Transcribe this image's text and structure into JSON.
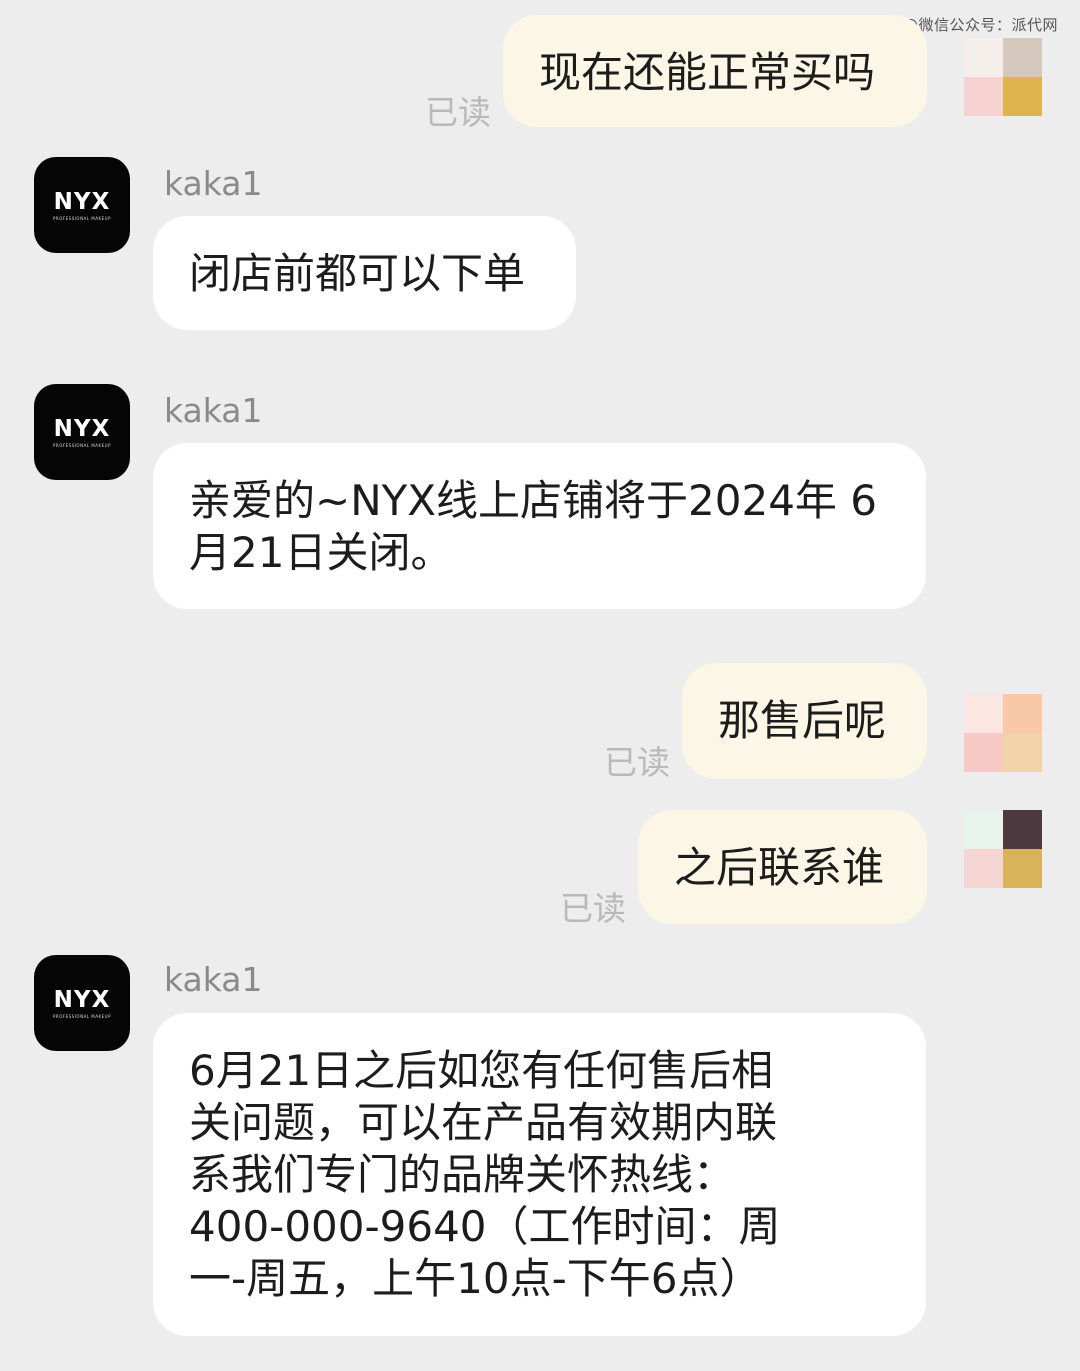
{
  "watermark": "@微信公众号：派代网",
  "read_label": "已读",
  "messages": {
    "m1": {
      "text": "现在还能正常买吗",
      "read": "已读"
    },
    "m2": {
      "sender": "kaka1",
      "text": "闭店前都可以下单",
      "avatar_logo": "NYX",
      "avatar_sub": "PROFESSIONAL MAKEUP"
    },
    "m3": {
      "sender": "kaka1",
      "line1": "亲爱的~NYX线上店铺将于2024年 6",
      "line2": "月21日关闭。",
      "avatar_logo": "NYX",
      "avatar_sub": "PROFESSIONAL MAKEUP"
    },
    "m4": {
      "text": "那售后呢",
      "read": "已读"
    },
    "m5": {
      "text": "之后联系谁",
      "read": "已读"
    },
    "m6": {
      "sender": "kaka1",
      "lines": [
        "6月21日之后如您有任何售后相",
        "关问题，可以在产品有效期内联",
        "系我们专门的品牌关怀热线：",
        "400-000-9640（工作时间：周",
        "一-周五，上午10点-下午6点）"
      ],
      "avatar_logo": "NYX",
      "avatar_sub": "PROFESSIONAL MAKEUP"
    }
  },
  "colors": {
    "background": "#ededed",
    "outgoing_bubble": "#fbf6e6",
    "incoming_bubble": "#ffffff",
    "read_text": "#b9b9b9",
    "sender_text": "#8a8a8a"
  }
}
